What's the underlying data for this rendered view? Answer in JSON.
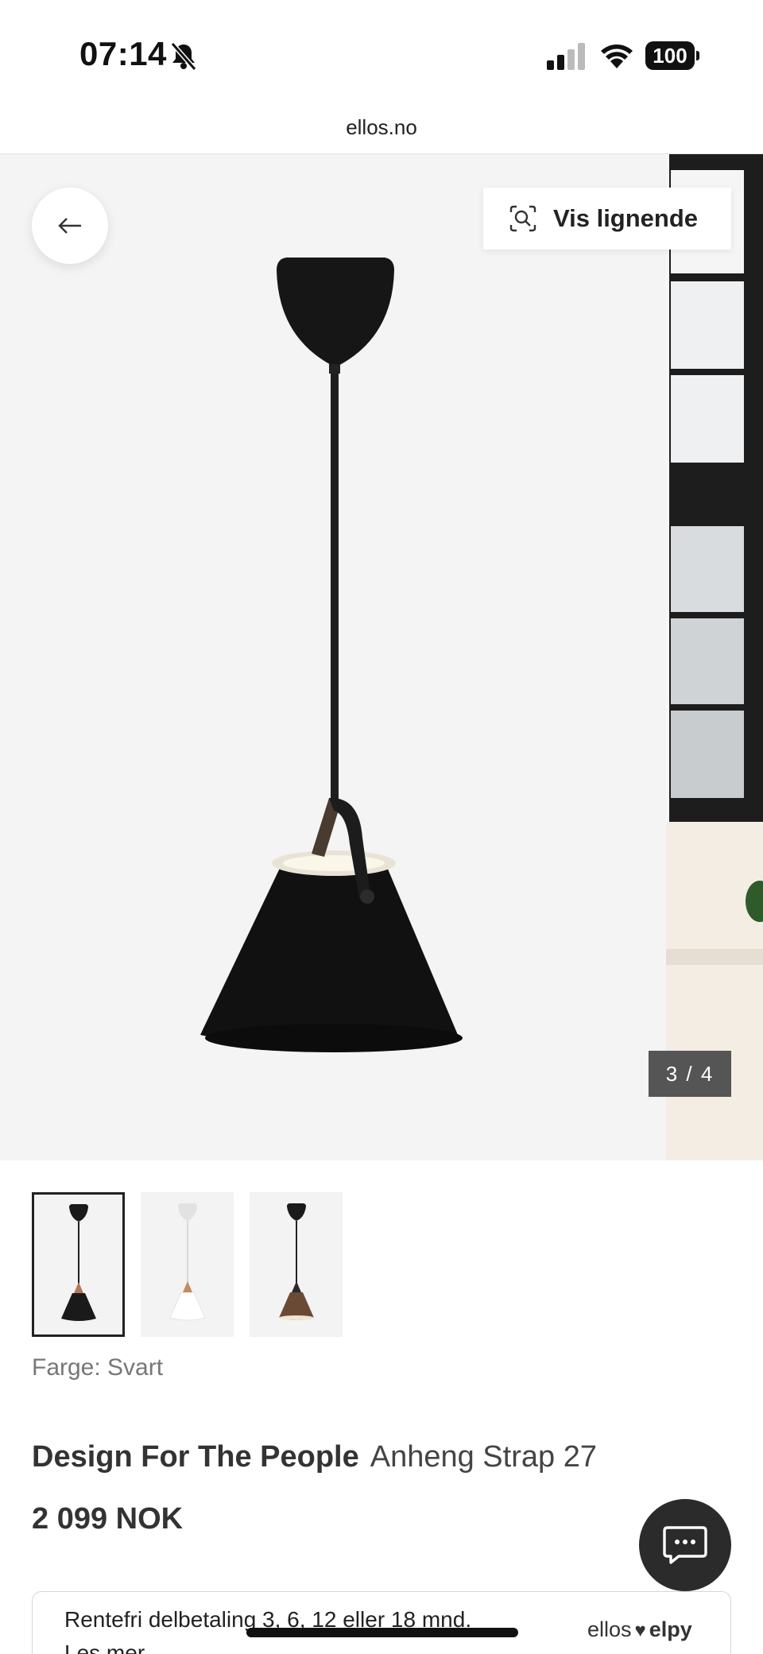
{
  "status_bar": {
    "time": "07:14",
    "battery": "100",
    "icons": [
      "bell-slash-icon",
      "cellular-signal-icon",
      "wifi-icon",
      "battery-icon"
    ]
  },
  "browser": {
    "url": "ellos.no"
  },
  "gallery": {
    "similar_label": "Vis lignende",
    "pager": "3 / 4",
    "thumbnails": [
      {
        "color": "#1f1f1f",
        "selected": true
      },
      {
        "color": "#ffffff",
        "selected": false
      },
      {
        "color": "#6b4a35",
        "selected": false
      }
    ]
  },
  "product": {
    "color_label": "Farge: Svart",
    "brand": "Design For The People",
    "name": "Anheng Strap 27",
    "price": "2 099 NOK"
  },
  "finance": {
    "text": "Rentefri delbetaling 3, 6, 12 eller 18 mnd.",
    "link": "Les mer",
    "logo_left": "ellos",
    "logo_right": "elpy"
  },
  "colors": {
    "accent_dark": "#2b2b2b",
    "pager_bg": "#555555",
    "hero_bg": "#f4f4f4"
  }
}
